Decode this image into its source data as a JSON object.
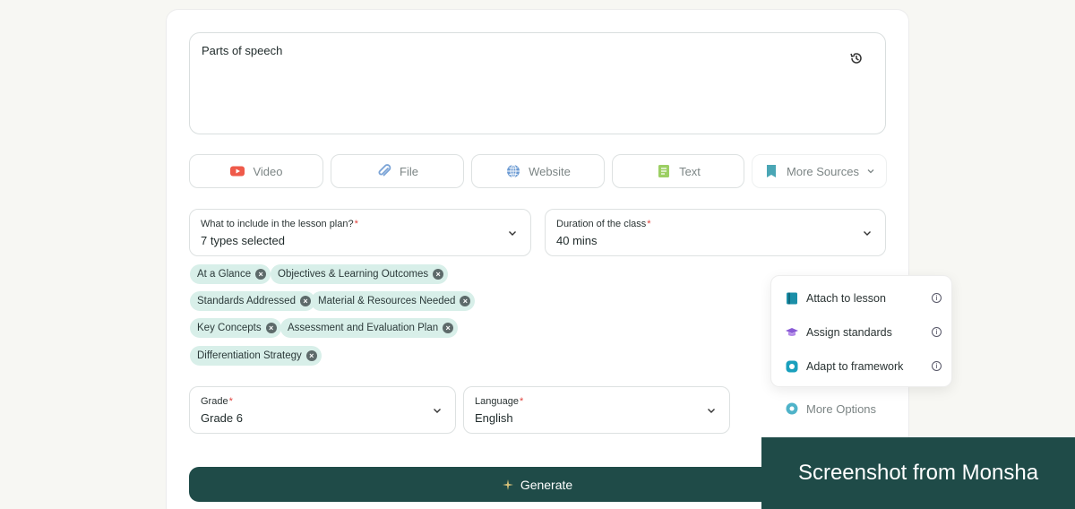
{
  "prompt": {
    "text": "Parts of speech"
  },
  "sources": [
    {
      "label": "Video",
      "icon": "youtube-icon"
    },
    {
      "label": "File",
      "icon": "paperclip-icon"
    },
    {
      "label": "Website",
      "icon": "globe-icon"
    },
    {
      "label": "Text",
      "icon": "text-document-icon"
    },
    {
      "label": "More Sources",
      "icon": "book-icon"
    }
  ],
  "include_field": {
    "label": "What to include in the lesson plan?",
    "required": "*",
    "value": "7 types selected"
  },
  "duration_field": {
    "label": "Duration of the class",
    "required": "*",
    "value": "40 mins"
  },
  "chips": [
    "At a Glance",
    "Objectives & Learning Outcomes",
    "Standards Addressed",
    "Material & Resources Needed",
    "Key Concepts",
    "Assessment and Evaluation Plan",
    "Differentiation Strategy"
  ],
  "grade_field": {
    "label": "Grade",
    "required": "*",
    "value": "Grade 6"
  },
  "language_field": {
    "label": "Language",
    "required": "*",
    "value": "English"
  },
  "options_menu": [
    {
      "label": "Attach to lesson",
      "icon": "book-icon"
    },
    {
      "label": "Assign standards",
      "icon": "graduation-cap-icon"
    },
    {
      "label": "Adapt to framework",
      "icon": "framework-icon"
    }
  ],
  "more_options": {
    "label": "More Options",
    "icon": "gear-icon"
  },
  "generate": {
    "label": "Generate",
    "icon": "sparkle-icon"
  },
  "watermark": {
    "text": "Screenshot from Monsha"
  },
  "colors": {
    "primary": "#1f4b48",
    "chip_bg": "#d8efe9",
    "required": "#e0413b"
  }
}
